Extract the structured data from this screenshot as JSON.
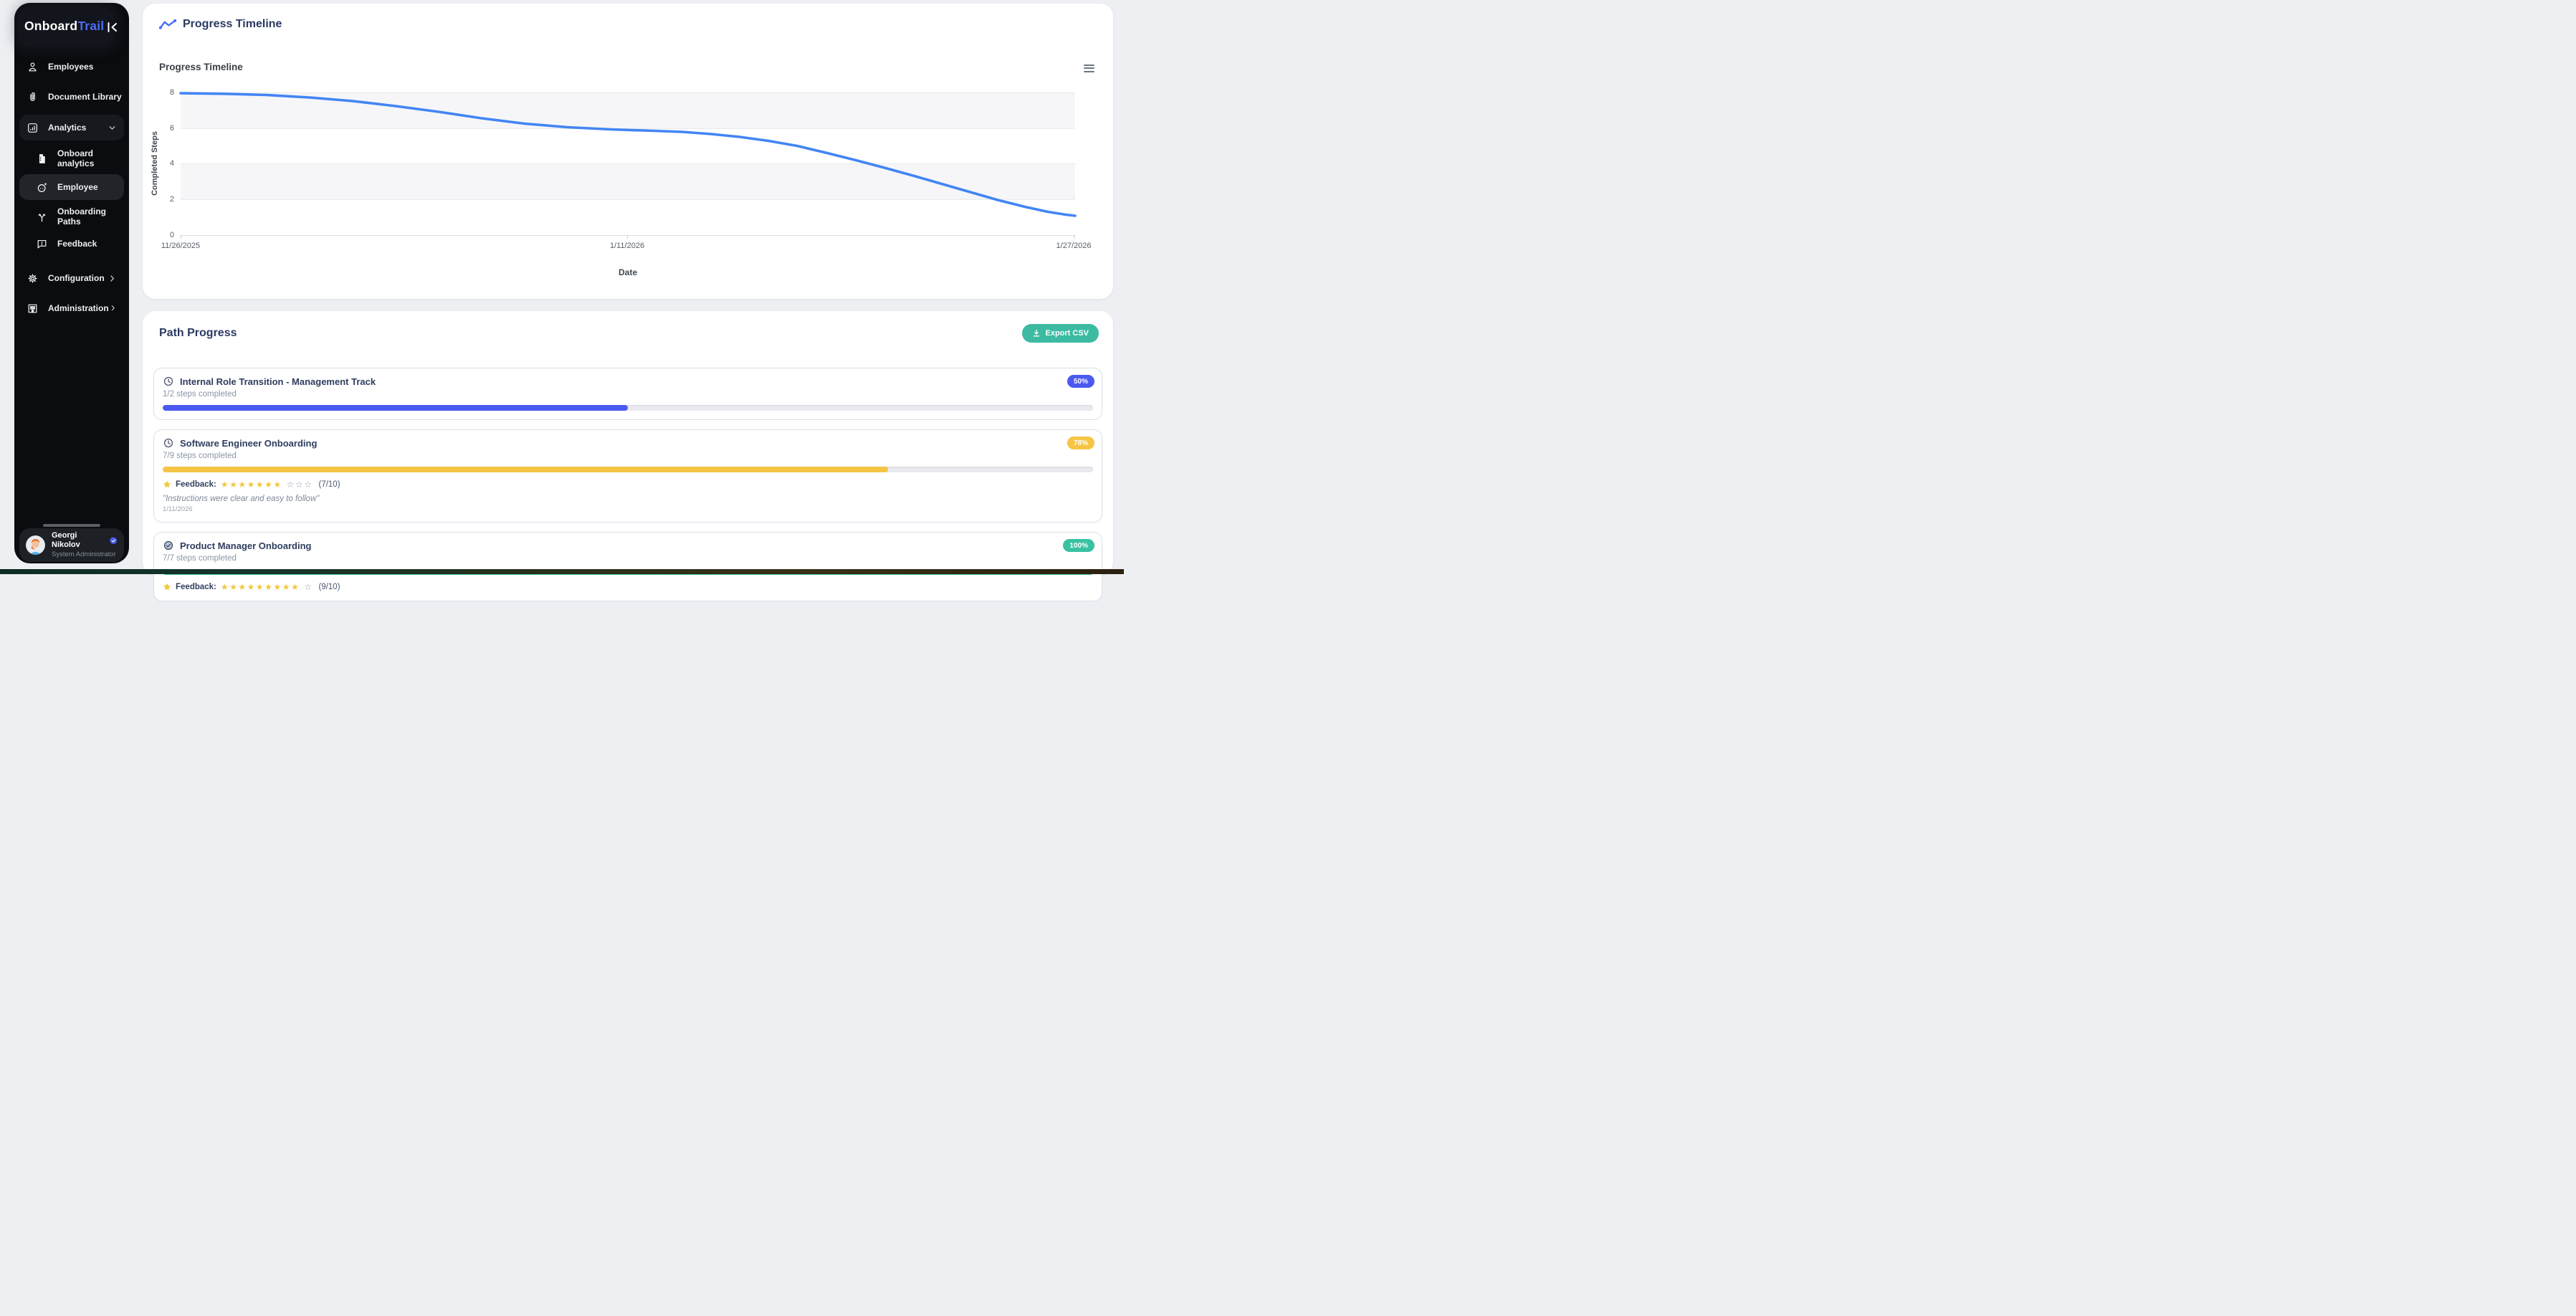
{
  "sidebar": {
    "logo": {
      "part1": "Onboard",
      "part2": "Trail",
      "accent_color": "#4a6df5"
    },
    "collapse_icon": "collapse-sidebar-icon",
    "items": [
      {
        "label": "Employees",
        "icon": "person-icon"
      },
      {
        "label": "Document Library",
        "icon": "paperclip-icon"
      },
      {
        "label": "Analytics",
        "icon": "bar-chart-icon",
        "active": true,
        "chevron": "down"
      },
      {
        "label": "Onboard analytics",
        "icon": "document-icon",
        "child": true
      },
      {
        "label": "Employee",
        "icon": "face-icon",
        "child": true,
        "selected": true
      },
      {
        "label": "Onboarding Paths",
        "icon": "branch-icon",
        "child": true
      },
      {
        "label": "Feedback",
        "icon": "feedback-icon",
        "child": true
      },
      {
        "label": "Configuration",
        "icon": "gear-icon",
        "chevron": "right"
      },
      {
        "label": "Administration",
        "icon": "building-icon",
        "chevron": "right"
      }
    ],
    "user": {
      "name": "Georgi Nikolov",
      "role": "System Administrator",
      "badge_icon": "verified-badge-icon"
    }
  },
  "header": {
    "title": "Progress Timeline",
    "icon": "trend-line-icon"
  },
  "chart_data": {
    "type": "line",
    "title": "Progress Timeline",
    "xlabel": "Date",
    "ylabel": "Completed Steps",
    "x": [
      "11/26/2025",
      "1/11/2026",
      "1/27/2026"
    ],
    "series": [
      {
        "name": "Completed Steps",
        "smooth": true,
        "values": [
          8,
          6,
          1
        ]
      }
    ],
    "yticks": [
      "8",
      "6",
      "4",
      "2",
      "0"
    ],
    "ylim": [
      0,
      8
    ],
    "grid": "horizontal bands, alternating",
    "legend": "off",
    "line_color": "#4285f4",
    "band_color": "#f6f6f8",
    "menu_icon": "hamburger-menu-icon"
  },
  "path_progress": {
    "title": "Path Progress",
    "export_button": {
      "label": "Export CSV",
      "icon": "download-icon",
      "color": "#3cbaa2"
    },
    "cards": [
      {
        "icon": "clock-icon",
        "title": "Internal Role Transition - Management Track",
        "steps": "1/2 steps completed",
        "percent": "50%",
        "progress": 50,
        "color": "#4a5af0"
      },
      {
        "icon": "clock-icon",
        "title": "Software Engineer Onboarding",
        "steps": "7/9 steps completed",
        "percent": "78%",
        "progress": 78,
        "color": "#f6c545",
        "feedback": {
          "label": "Feedback:",
          "stars_filled": 7,
          "stars_total": 10,
          "rating": "(7/10)",
          "quote": "\"Instructions were clear and easy to follow\"",
          "date": "1/11/2026"
        }
      },
      {
        "icon": "check-circle-icon",
        "title": "Product Manager Onboarding",
        "steps": "7/7 steps completed",
        "percent": "100%",
        "progress": 100,
        "color": "#38c2a2",
        "feedback": {
          "label": "Feedback:",
          "stars_filled": 9,
          "stars_total": 10,
          "rating": "(9/10)"
        }
      }
    ]
  }
}
